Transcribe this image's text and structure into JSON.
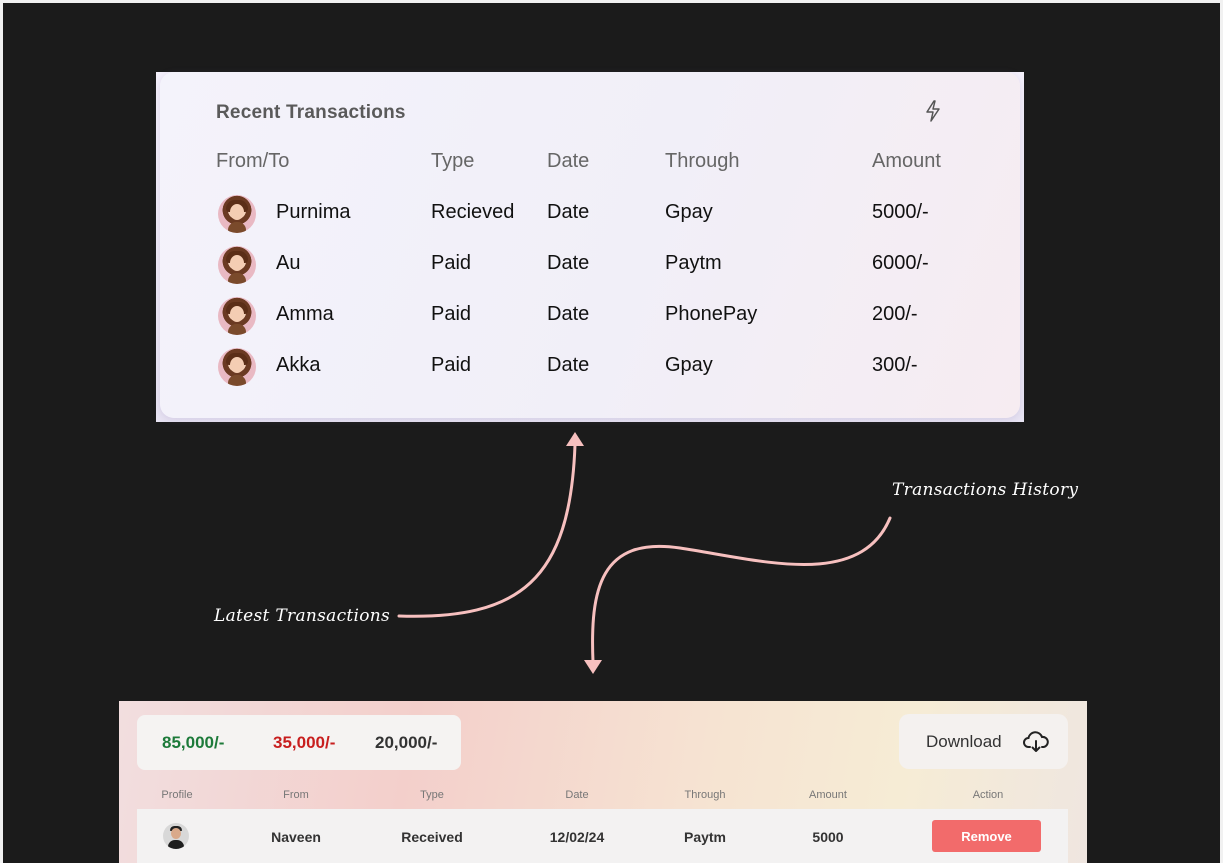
{
  "recent": {
    "title": "Recent Transactions",
    "icon": "lightning-icon",
    "headers": {
      "from_to": "From/To",
      "type": "Type",
      "date": "Date",
      "through": "Through",
      "amount": "Amount"
    },
    "rows": [
      {
        "name": "Purnima",
        "type": "Recieved",
        "date": "Date",
        "through": "Gpay",
        "amount": "5000/-"
      },
      {
        "name": "Au",
        "type": "Paid",
        "date": "Date",
        "through": "Paytm",
        "amount": "6000/-"
      },
      {
        "name": "Amma",
        "type": "Paid",
        "date": "Date",
        "through": "PhonePay",
        "amount": "200/-"
      },
      {
        "name": "Akka",
        "type": "Paid",
        "date": "Date",
        "through": "Gpay",
        "amount": "300/-"
      }
    ]
  },
  "annotations": {
    "latest": "Latest Transactions",
    "history": "Transactions History"
  },
  "history": {
    "totals": {
      "received": "85,000/-",
      "paid": "35,000/-",
      "balance": "20,000/-"
    },
    "download_label": "Download",
    "headers": {
      "profile": "Profile",
      "from": "From",
      "type": "Type",
      "date": "Date",
      "through": "Through",
      "amount": "Amount",
      "action": "Action"
    },
    "rows": [
      {
        "from": "Naveen",
        "type": "Received",
        "date": "12/02/24",
        "through": "Paytm",
        "amount": "5000",
        "action": "Remove"
      }
    ]
  },
  "colors": {
    "background": "#1b1b1b",
    "positive": "#1d7a3a",
    "negative": "#c81e1e",
    "remove_button": "#f26b6b",
    "arrow": "#f7c0bf"
  }
}
